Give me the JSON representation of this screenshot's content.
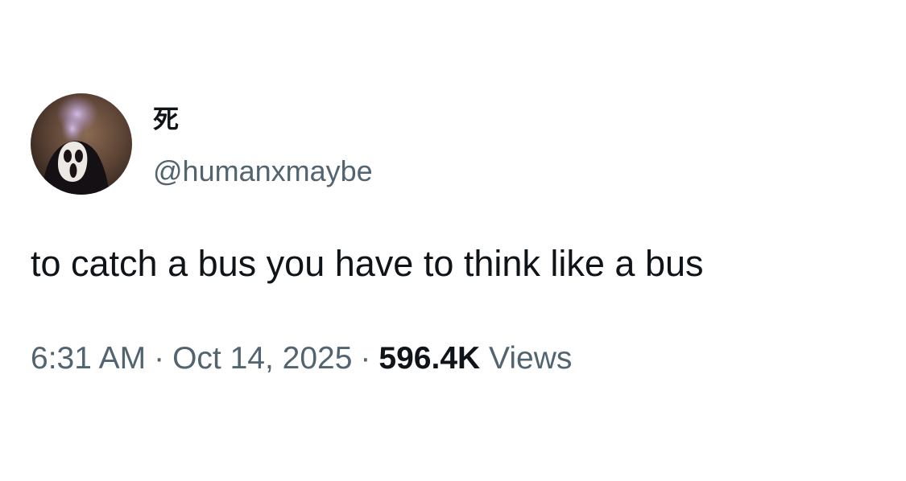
{
  "tweet": {
    "author": {
      "display_name": "死",
      "handle": "@humanxmaybe",
      "avatar_icon": "ghostface-mask-avatar"
    },
    "text": "to catch a bus you have to think like a bus",
    "time": "6:31 AM",
    "separator": "·",
    "date": "Oct 14, 2025",
    "views_count": "596.4K",
    "views_label": "Views"
  },
  "colors": {
    "text_primary": "#0f1419",
    "text_secondary": "#536471",
    "background": "#ffffff"
  }
}
